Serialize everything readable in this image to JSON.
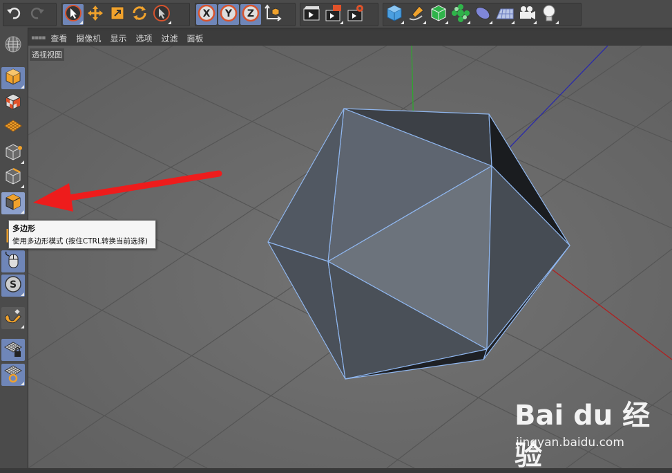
{
  "menubar": {
    "items": [
      "查看",
      "摄像机",
      "显示",
      "选项",
      "过滤",
      "面板"
    ]
  },
  "viewport": {
    "label": "透视视图"
  },
  "tooltip": {
    "title": "多边形",
    "description": "使用多边形模式 (按住CTRL转换当前选择)"
  },
  "watermark": {
    "brand": "Bai du 经验",
    "url": "jingyan.baidu.com"
  },
  "icons": {
    "top_toolbar": [
      "undo-icon",
      "redo-icon",
      "live-selection-icon",
      "move-icon",
      "scale-icon",
      "rotate-icon",
      "recent-tool-icon",
      "x-axis-icon",
      "y-axis-icon",
      "z-axis-icon",
      "world-coordinate-icon",
      "render-view-icon",
      "render-picture-viewer-icon",
      "render-settings-icon",
      "cube-primitive-icon",
      "pen-spline-icon",
      "subdivision-surface-icon",
      "cloner-icon",
      "deformer-icon",
      "floor-icon",
      "camera-icon",
      "light-icon"
    ],
    "left_toolbar": [
      "make-editable-icon",
      "model-mode-icon",
      "texture-mode-icon",
      "workplane-mode-icon",
      "points-mode-icon",
      "edges-mode-icon",
      "polygons-mode-icon",
      "axis-mode-icon",
      "tweak-mode-icon",
      "solo-mode-icon",
      "snap-icon",
      "locked-workplane-icon",
      "planar-workplane-icon"
    ]
  },
  "colors": {
    "toolbar_bg": "#4b4b4b",
    "viewport_bg": "#6a6a6a",
    "selected_button": "#6f86b8",
    "icon_orange": "#f0a22c",
    "mesh_edge": "#8fb6ee",
    "arrow_red": "#ee1c1c"
  }
}
